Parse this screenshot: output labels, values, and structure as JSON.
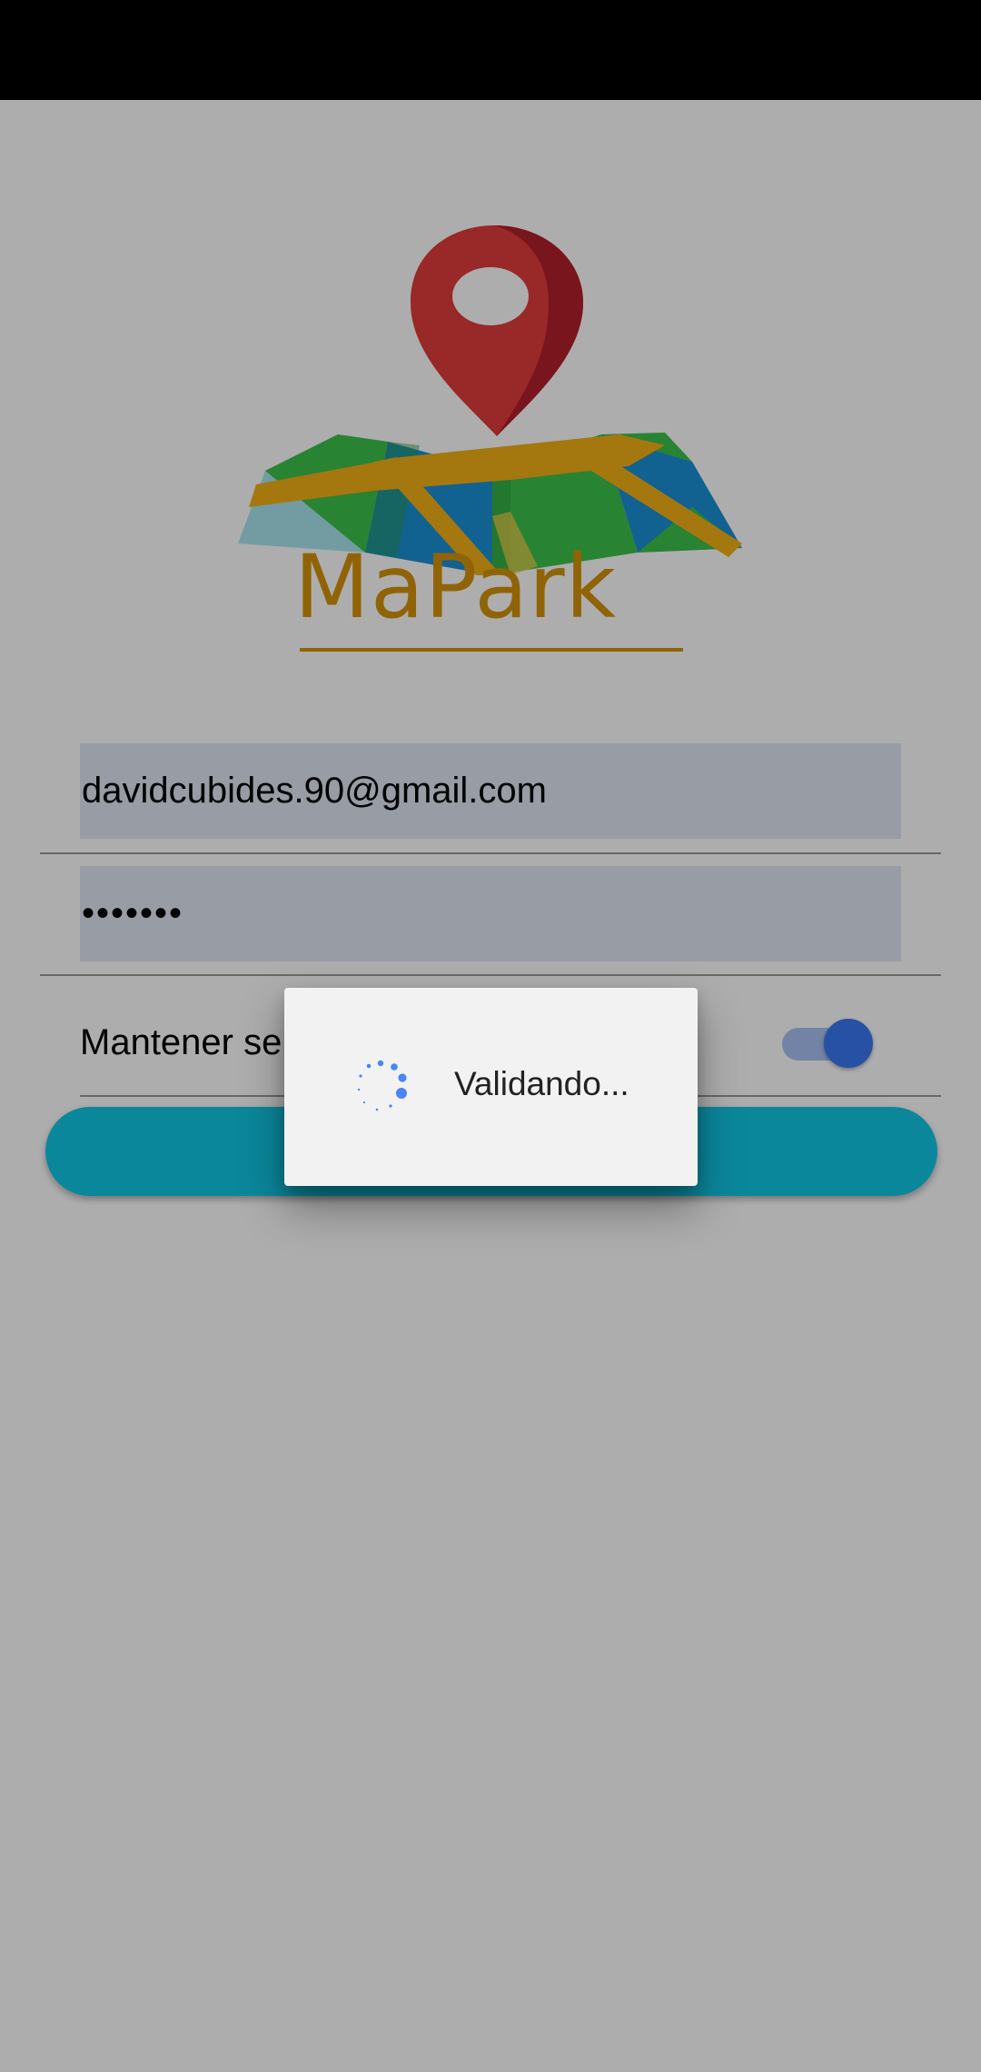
{
  "app": {
    "logo_text": "MaPark"
  },
  "form": {
    "email_value": "davidcubides.90@gmail.com",
    "password_value": "•••••••",
    "keep_session_label": "Mantener se",
    "keep_session_on": true
  },
  "dialog": {
    "message": "Validando..."
  },
  "colors": {
    "button": "#11c7e6",
    "toggle_thumb": "#3a78f2",
    "field_fill": "#dfe6f3",
    "pin": "#e23b3b",
    "map_green": "#3cc14a",
    "map_blue": "#1a8fd6",
    "road": "#f2b117",
    "logo_text": "#d4940a"
  }
}
